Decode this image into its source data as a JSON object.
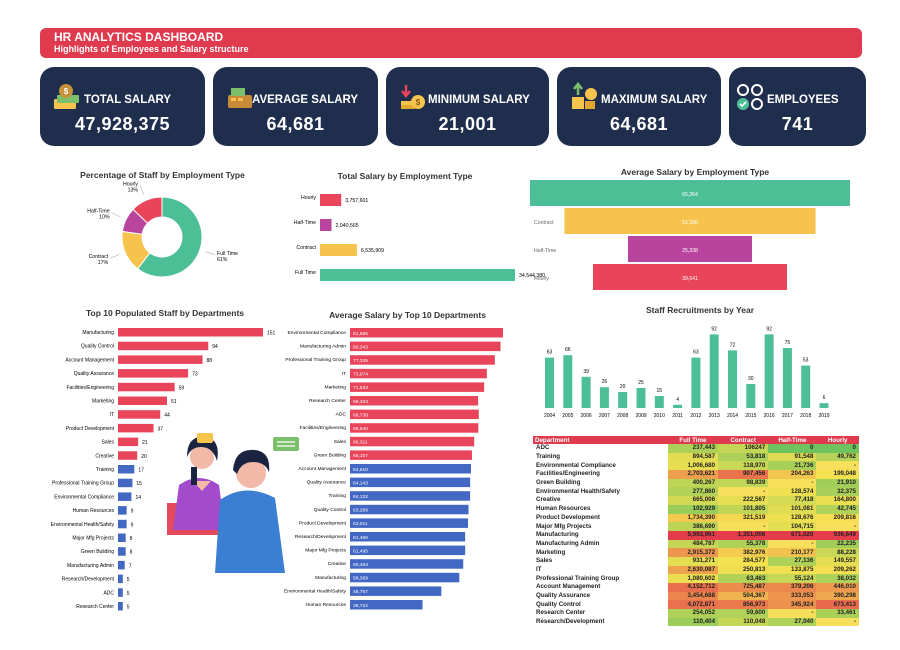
{
  "header": {
    "title": "HR ANALYTICS DASHBOARD",
    "subtitle": "Highlights of Employees and Salary structure"
  },
  "kpis": [
    {
      "label": "TOTAL SALARY",
      "value": "47,928,375",
      "icon": "money-bag-icon"
    },
    {
      "label": "AVERAGE SALARY",
      "value": "64,681",
      "icon": "cash-register-icon"
    },
    {
      "label": "MINIMUM SALARY",
      "value": "21,001",
      "icon": "coins-down-icon"
    },
    {
      "label": "MAXIMUM SALARY",
      "value": "64,681",
      "icon": "coins-up-icon"
    },
    {
      "label": "EMPLOYEES",
      "value": "741",
      "icon": "people-icon"
    }
  ],
  "colors": {
    "red": "#e8445a",
    "green": "#4dbf97",
    "purple": "#b8449e",
    "yellow": "#f6c44d",
    "blue": "#4268c4",
    "navy": "#1f2e4d"
  },
  "chart_data": [
    {
      "id": "pct",
      "type": "pie",
      "title": "Percentage of Staff by Employment Type",
      "categories": [
        "Full Time",
        "Contract",
        "Half-Time",
        "Hourly"
      ],
      "values": [
        61,
        17,
        10,
        13
      ],
      "labels": [
        "Full Time\n61%",
        "Contract\n17%",
        "Half-Time\n10%",
        "Hourly\n13%"
      ]
    },
    {
      "id": "tot",
      "type": "bar",
      "title": "Total Salary by Employment Type",
      "categories": [
        "Hourly",
        "Half-Time",
        "Contract",
        "Full Time"
      ],
      "values": [
        3757601,
        2040565,
        6535909,
        34544380
      ],
      "labels": [
        "3,757,601",
        "2,040,565",
        "6,535,909",
        "34,544,380"
      ]
    },
    {
      "id": "avg",
      "type": "bar",
      "title": "Average Salary by Employment Type",
      "categories": [
        "Full Time",
        "Contract",
        "Half-Time",
        "Hourly"
      ],
      "values": [
        65364,
        51300,
        25338,
        39641
      ],
      "labels": [
        "65,364",
        "51,300",
        "25,338",
        "39,641"
      ]
    },
    {
      "id": "dept",
      "type": "bar",
      "title": "Top 10 Populated Staff by Departments",
      "categories": [
        "Manufacturing",
        "Quality Control",
        "Account Management",
        "Quality Assurance",
        "Facilities/Engineering",
        "Marketing",
        "IT",
        "Product Development",
        "Sales",
        "Creative",
        "Training",
        "Professional Training Group",
        "Environmental Compliance",
        "Human Resources",
        "Environmental Health/Safety",
        "Major Mfg Projects",
        "Green Building",
        "Manufacturing Admin",
        "Research/Development",
        "ADC",
        "Research Center"
      ],
      "values": [
        151,
        94,
        88,
        73,
        59,
        51,
        44,
        37,
        21,
        20,
        17,
        15,
        14,
        9,
        9,
        8,
        8,
        7,
        5,
        5,
        5
      ]
    },
    {
      "id": "avgdept",
      "type": "bar",
      "title": "Average Salary by Top 10 Departments",
      "categories": [
        "Environmental Compliance",
        "Manufacturing Admin",
        "Professional Training Group",
        "IT",
        "Marketing",
        "Research Center",
        "ADC",
        "Facilities/Engineering",
        "Sales",
        "Green Building",
        "Account Management",
        "Quality Assurance",
        "Training",
        "Quality Control",
        "Product Development",
        "Research/Development",
        "Major Mfg Projects",
        "Creative",
        "Manufacturing",
        "Environmental Health/Safety",
        "Human Resources"
      ],
      "values": [
        81685,
        80343,
        77335,
        73074,
        71633,
        68403,
        68738,
        68540,
        66311,
        65107,
        64610,
        64143,
        64132,
        63289,
        63011,
        61466,
        61495,
        60463,
        58369,
        48757,
        38722
      ],
      "labels": [
        "81,685",
        "80,343",
        "77,335",
        "73,074",
        "71,633",
        "68,403",
        "68,738",
        "68,540",
        "66,311",
        "65,107",
        "64,610",
        "64,143",
        "64,132",
        "63,289",
        "63,011",
        "61,466",
        "61,495",
        "60,463",
        "58,369",
        "48,757",
        "38,722"
      ]
    },
    {
      "id": "rec",
      "type": "bar",
      "title": "Staff Recruitments by Year",
      "categories": [
        "2004",
        "2005",
        "2006",
        "2007",
        "2008",
        "2009",
        "2010",
        "2011",
        "2012",
        "2013",
        "2014",
        "2015",
        "2016",
        "2017",
        "2018",
        "2019"
      ],
      "values": [
        63,
        66,
        39,
        26,
        20,
        25,
        15,
        4,
        63,
        92,
        72,
        30,
        92,
        75,
        53,
        6
      ]
    },
    {
      "id": "table",
      "type": "table",
      "title": "",
      "columns": [
        "Department",
        "Full Time",
        "Contract",
        "Half-Time",
        "Hourly"
      ],
      "rows": [
        [
          "ADC",
          "237,443",
          "106247",
          "0",
          "0"
        ],
        [
          "Training",
          "894,587",
          "53,818",
          "91,548",
          "49,762"
        ],
        [
          "Environmental Compliance",
          "1,006,680",
          "118,970",
          "21,736",
          "-"
        ],
        [
          "Facilities/Engineering",
          "2,703,621",
          "907,456",
          "204,263",
          "199,048"
        ],
        [
          "Green Building",
          "400,267",
          "98,839",
          "-",
          "21,910"
        ],
        [
          "Environmental Health/Safety",
          "277,860",
          "-",
          "128,574",
          "32,375"
        ],
        [
          "Creative",
          "665,006",
          "222,567",
          "77,418",
          "164,800"
        ],
        [
          "Human Resources",
          "102,929",
          "101,805",
          "101,081",
          "42,745"
        ],
        [
          "Product Development",
          "1,734,390",
          "321,519",
          "128,676",
          "209,816"
        ],
        [
          "Major Mfg Projects",
          "386,690",
          "-",
          "104,715",
          "-"
        ],
        [
          "Manufacturing",
          "5,993,961",
          "1,351,006",
          "671,020",
          "936,649"
        ],
        [
          "Manufacturing Admin",
          "484,787",
          "55,378",
          "-",
          "22,235"
        ],
        [
          "Marketing",
          "2,915,372",
          "382,976",
          "210,177",
          "88,228"
        ],
        [
          "Sales",
          "931,271",
          "284,577",
          "27,136",
          "149,557"
        ],
        [
          "IT",
          "2,630,087",
          "250,813",
          "133,875",
          "209,262"
        ],
        [
          "Professional Training Group",
          "1,080,602",
          "63,463",
          "55,124",
          "38,032"
        ],
        [
          "Account Management",
          "4,152,712",
          "725,487",
          "379,206",
          "446,010"
        ],
        [
          "Quality Assurance",
          "3,454,688",
          "504,367",
          "333,053",
          "390,298"
        ],
        [
          "Quality Control",
          "4,072,871",
          "856,973",
          "345,924",
          "673,413"
        ],
        [
          "Research Center",
          "254,052",
          "59,600",
          "-",
          "33,461"
        ],
        [
          "Research/Development",
          "110,404",
          "110,048",
          "27,040",
          "-"
        ]
      ]
    }
  ]
}
